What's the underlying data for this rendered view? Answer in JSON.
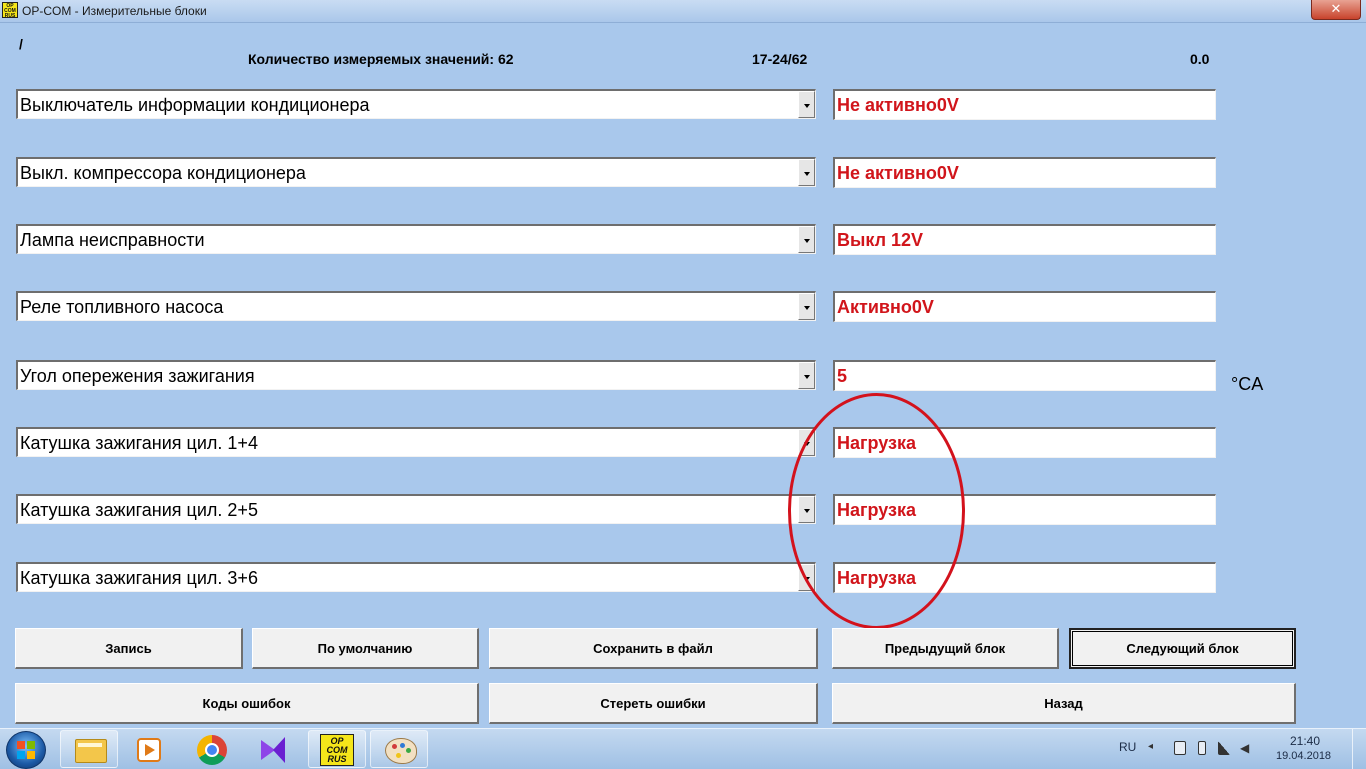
{
  "window": {
    "title": "OP-COM - Измерительные блоки",
    "app_icon_text": "OP\nCOM\nRUS",
    "close_symbol": "✕"
  },
  "header": {
    "slash": "/",
    "count_label": "Количество измеряемых значений: 62",
    "range": "17-24/62",
    "value": "0.0"
  },
  "rows": [
    {
      "label": "Выключатель информации кондиционера",
      "value": "Не активно0V"
    },
    {
      "label": "Выкл. компрессора кондиционера",
      "value": "Не активно0V"
    },
    {
      "label": "Лампа неисправности",
      "value": "Выкл 12V"
    },
    {
      "label": "Реле топливного насоса",
      "value": "Активно0V"
    },
    {
      "label": "Угол опережения зажигания",
      "value": "5",
      "unit": "°CA"
    },
    {
      "label": "Катушка зажигания цил. 1+4",
      "value": "Нагрузка"
    },
    {
      "label": "Катушка зажигания цил. 2+5",
      "value": "Нагрузка"
    },
    {
      "label": "Катушка зажигания цил. 3+6",
      "value": "Нагрузка"
    }
  ],
  "buttons": {
    "record": "Запись",
    "default": "По умолчанию",
    "save_file": "Сохранить в файл",
    "prev_block": "Предыдущий блок",
    "next_block": "Следующий блок",
    "error_codes": "Коды ошибок",
    "clear_errors": "Стереть ошибки",
    "back": "Назад"
  },
  "taskbar": {
    "opcom_icon_text": "OP\nCOM\nRUS",
    "language": "RU",
    "time": "21:40",
    "date": "19.04.2018",
    "apps": [
      "windows-start-icon",
      "file-explorer-icon",
      "media-player-icon",
      "chrome-icon",
      "visual-studio-icon",
      "opcom-icon",
      "paint-icon"
    ]
  },
  "colors": {
    "background": "#a9c8ec",
    "value_text": "#d1151b",
    "annotation": "#d3121c"
  }
}
